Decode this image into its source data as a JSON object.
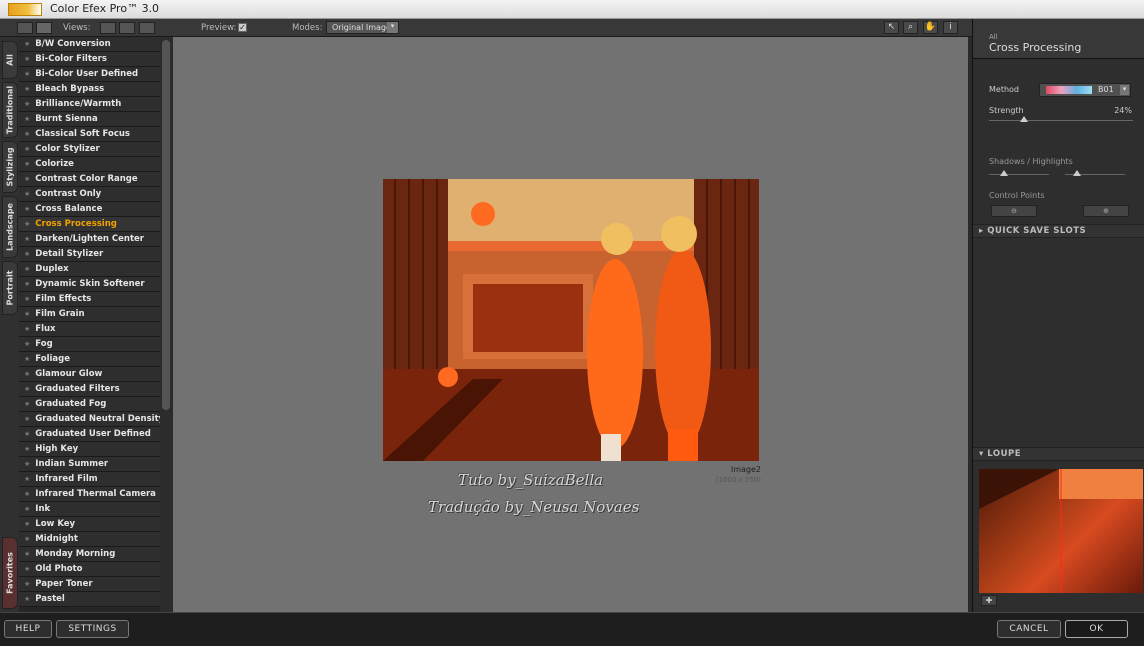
{
  "window": {
    "title": "Color Efex Pro™ 3.0"
  },
  "toolbar": {
    "views_label": "Views:",
    "preview_label": "Preview:",
    "preview_checked": "✓",
    "modes_label": "Modes:",
    "mode_value": "Original Image"
  },
  "tabs": [
    "All",
    "Traditional",
    "Stylizing",
    "Landscape",
    "Portrait",
    "Favorites"
  ],
  "filters": [
    "B/W Conversion",
    "Bi-Color Filters",
    "Bi-Color User Defined",
    "Bleach Bypass",
    "Brilliance/Warmth",
    "Burnt Sienna",
    "Classical Soft Focus",
    "Color Stylizer",
    "Colorize",
    "Contrast Color Range",
    "Contrast Only",
    "Cross Balance",
    "Cross Processing",
    "Darken/Lighten Center",
    "Detail Stylizer",
    "Duplex",
    "Dynamic Skin Softener",
    "Film Effects",
    "Film Grain",
    "Flux",
    "Fog",
    "Foliage",
    "Glamour Glow",
    "Graduated Filters",
    "Graduated Fog",
    "Graduated Neutral Density",
    "Graduated User Defined",
    "High Key",
    "Indian Summer",
    "Infrared Film",
    "Infrared Thermal Camera",
    "Ink",
    "Low Key",
    "Midnight",
    "Monday Morning",
    "Old Photo",
    "Paper Toner",
    "Pastel"
  ],
  "selected_filter_index": 12,
  "image": {
    "name": "Image2",
    "size": "(1000 x 750)"
  },
  "watermark": {
    "line1": "Tuto by_SuizaBella",
    "line2": "Tradução by_Neusa Novaes"
  },
  "panel": {
    "category": "All",
    "title": "Cross Processing",
    "method_label": "Method",
    "method_value": "B01",
    "strength_label": "Strength",
    "strength_value": "24%",
    "strength_fraction": 0.24,
    "shadows_label": "Shadows / Highlights",
    "control_points_label": "Control Points",
    "quick_save_label": "QUICK SAVE SLOTS",
    "loupe_label": "LOUPE"
  },
  "bottom": {
    "help": "HELP",
    "settings": "SETTINGS",
    "cancel": "CANCEL",
    "ok": "OK"
  }
}
